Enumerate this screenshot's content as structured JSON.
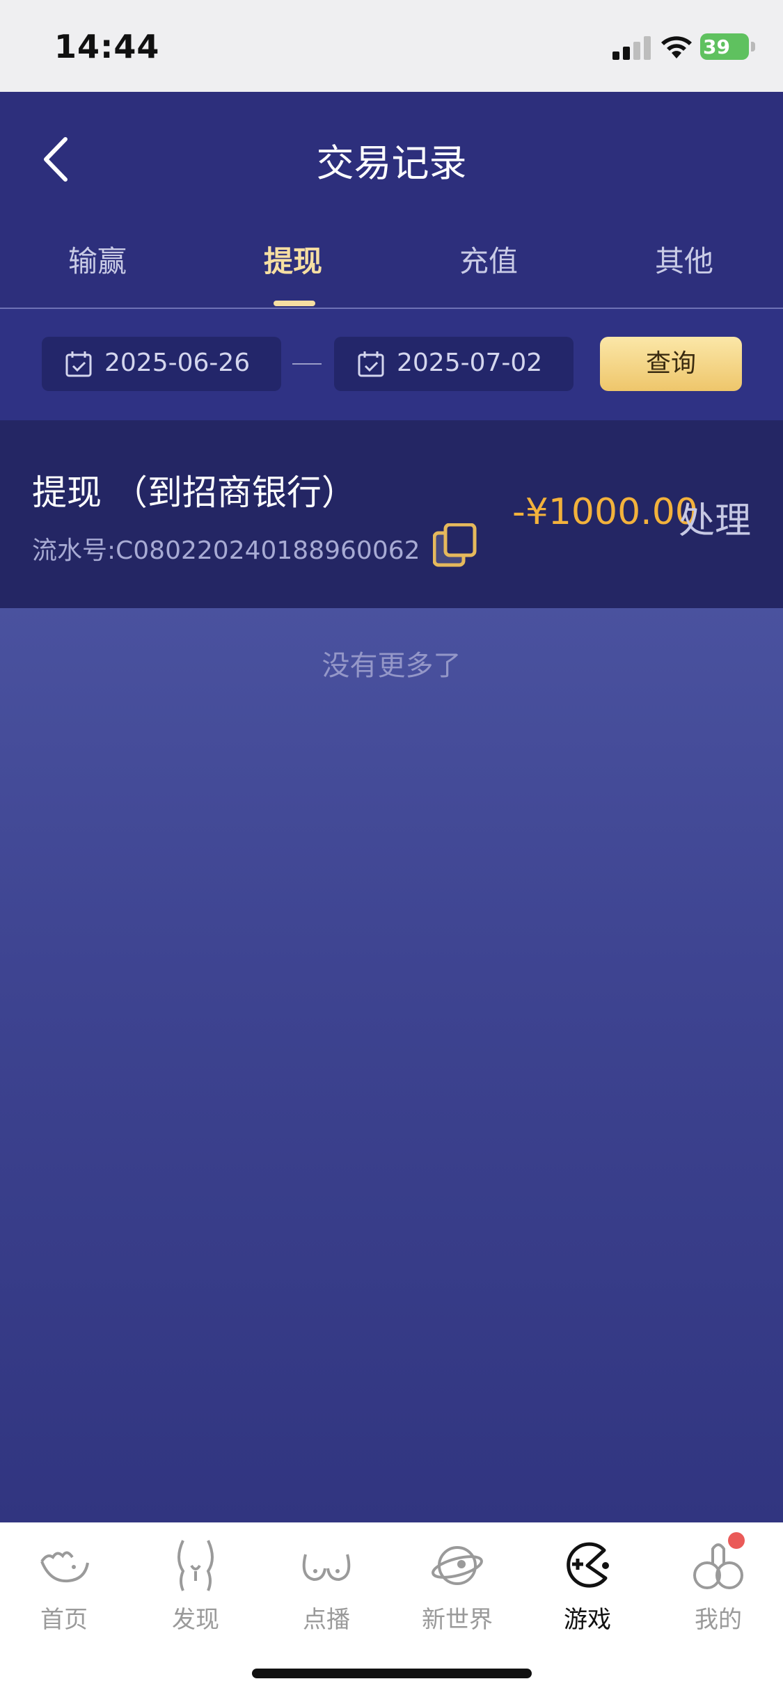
{
  "status_bar": {
    "time": "14:44",
    "battery": "39"
  },
  "header": {
    "title": "交易记录"
  },
  "tabs": [
    {
      "label": "输赢",
      "active": false
    },
    {
      "label": "提现",
      "active": true
    },
    {
      "label": "充值",
      "active": false
    },
    {
      "label": "其他",
      "active": false
    }
  ],
  "filter": {
    "start_date": "2025-06-26",
    "end_date": "2025-07-02",
    "query_label": "查询"
  },
  "records": [
    {
      "title": "提现 （到招商银行）",
      "serial": "流水号:C080220240188960062",
      "amount": "-¥1000.00",
      "status": "处理"
    }
  ],
  "footer_text": "没有更多了",
  "bottom_nav": [
    {
      "label": "首页",
      "icon": "home-icon",
      "active": false
    },
    {
      "label": "发现",
      "icon": "discover-icon",
      "active": false
    },
    {
      "label": "点播",
      "icon": "on-demand-icon",
      "active": false
    },
    {
      "label": "新世界",
      "icon": "planet-icon",
      "active": false
    },
    {
      "label": "游戏",
      "icon": "game-icon",
      "active": true
    },
    {
      "label": "我的",
      "icon": "profile-icon",
      "active": false,
      "badge": true
    }
  ],
  "colors": {
    "header_bg": "#2d2f7c",
    "accent_gold": "#f6dfa2",
    "amount_orange": "#f3b23c",
    "record_bg": "#242664"
  }
}
